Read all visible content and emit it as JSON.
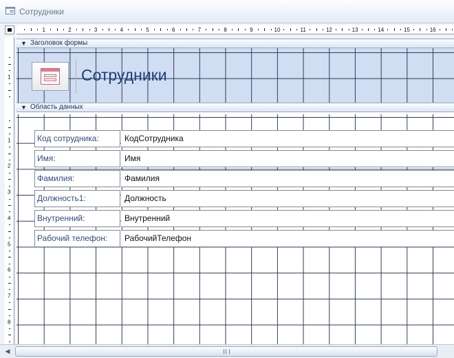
{
  "window": {
    "title": "Сотрудники",
    "icon": "form-window-icon"
  },
  "ruler": {
    "horizontal_numbers": [
      "1",
      "2",
      "3",
      "4",
      "5",
      "6",
      "7",
      "8",
      "9",
      "10",
      "11",
      "12",
      "13",
      "14",
      "15",
      "16"
    ],
    "vertical_numbers_header": [
      "1"
    ],
    "vertical_numbers_detail": [
      "1",
      "2",
      "3",
      "4",
      "5",
      "6",
      "7",
      "8"
    ]
  },
  "sections": {
    "header": {
      "label": "Заголовок формы",
      "title": "Сотрудники",
      "logo_icon": "form-icon"
    },
    "detail": {
      "label": "Область данных"
    }
  },
  "fields": [
    {
      "label": "Код сотрудника:",
      "value": "КодСотрудника"
    },
    {
      "label": "Имя:",
      "value": "Имя"
    },
    {
      "label": "Фамилия:",
      "value": "Фамилия"
    },
    {
      "label": "Должность1:",
      "value": "Должность"
    },
    {
      "label": "Внутренний:",
      "value": "Внутренний"
    },
    {
      "label": "Рабочий телефон:",
      "value": "РабочийТелефон"
    }
  ],
  "colors": {
    "header_bg": "#d0ddf2",
    "label_text": "#2f4f7f",
    "title_text": "#1f3f78",
    "grid_line": "#2e3c54"
  }
}
